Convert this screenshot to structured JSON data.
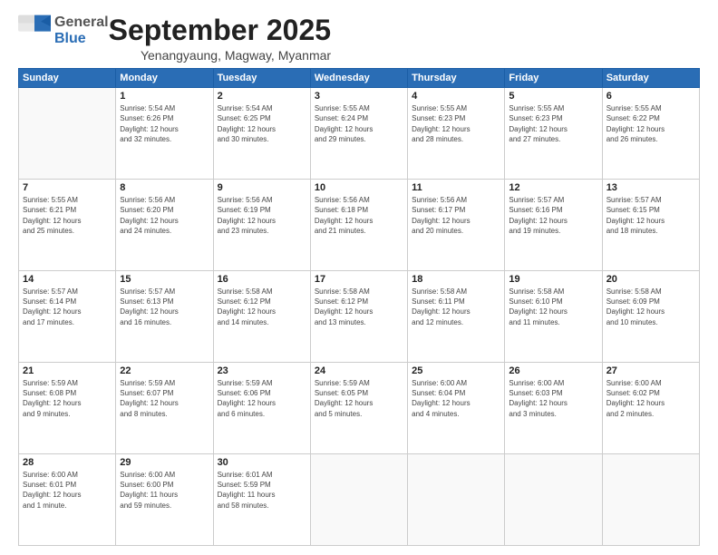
{
  "logo": {
    "general": "General",
    "blue": "Blue"
  },
  "title": "September 2025",
  "subtitle": "Yenangyaung, Magway, Myanmar",
  "days_of_week": [
    "Sunday",
    "Monday",
    "Tuesday",
    "Wednesday",
    "Thursday",
    "Friday",
    "Saturday"
  ],
  "weeks": [
    [
      {
        "day": "",
        "info": ""
      },
      {
        "day": "1",
        "info": "Sunrise: 5:54 AM\nSunset: 6:26 PM\nDaylight: 12 hours\nand 32 minutes."
      },
      {
        "day": "2",
        "info": "Sunrise: 5:54 AM\nSunset: 6:25 PM\nDaylight: 12 hours\nand 30 minutes."
      },
      {
        "day": "3",
        "info": "Sunrise: 5:55 AM\nSunset: 6:24 PM\nDaylight: 12 hours\nand 29 minutes."
      },
      {
        "day": "4",
        "info": "Sunrise: 5:55 AM\nSunset: 6:23 PM\nDaylight: 12 hours\nand 28 minutes."
      },
      {
        "day": "5",
        "info": "Sunrise: 5:55 AM\nSunset: 6:23 PM\nDaylight: 12 hours\nand 27 minutes."
      },
      {
        "day": "6",
        "info": "Sunrise: 5:55 AM\nSunset: 6:22 PM\nDaylight: 12 hours\nand 26 minutes."
      }
    ],
    [
      {
        "day": "7",
        "info": "Sunrise: 5:55 AM\nSunset: 6:21 PM\nDaylight: 12 hours\nand 25 minutes."
      },
      {
        "day": "8",
        "info": "Sunrise: 5:56 AM\nSunset: 6:20 PM\nDaylight: 12 hours\nand 24 minutes."
      },
      {
        "day": "9",
        "info": "Sunrise: 5:56 AM\nSunset: 6:19 PM\nDaylight: 12 hours\nand 23 minutes."
      },
      {
        "day": "10",
        "info": "Sunrise: 5:56 AM\nSunset: 6:18 PM\nDaylight: 12 hours\nand 21 minutes."
      },
      {
        "day": "11",
        "info": "Sunrise: 5:56 AM\nSunset: 6:17 PM\nDaylight: 12 hours\nand 20 minutes."
      },
      {
        "day": "12",
        "info": "Sunrise: 5:57 AM\nSunset: 6:16 PM\nDaylight: 12 hours\nand 19 minutes."
      },
      {
        "day": "13",
        "info": "Sunrise: 5:57 AM\nSunset: 6:15 PM\nDaylight: 12 hours\nand 18 minutes."
      }
    ],
    [
      {
        "day": "14",
        "info": "Sunrise: 5:57 AM\nSunset: 6:14 PM\nDaylight: 12 hours\nand 17 minutes."
      },
      {
        "day": "15",
        "info": "Sunrise: 5:57 AM\nSunset: 6:13 PM\nDaylight: 12 hours\nand 16 minutes."
      },
      {
        "day": "16",
        "info": "Sunrise: 5:58 AM\nSunset: 6:12 PM\nDaylight: 12 hours\nand 14 minutes."
      },
      {
        "day": "17",
        "info": "Sunrise: 5:58 AM\nSunset: 6:12 PM\nDaylight: 12 hours\nand 13 minutes."
      },
      {
        "day": "18",
        "info": "Sunrise: 5:58 AM\nSunset: 6:11 PM\nDaylight: 12 hours\nand 12 minutes."
      },
      {
        "day": "19",
        "info": "Sunrise: 5:58 AM\nSunset: 6:10 PM\nDaylight: 12 hours\nand 11 minutes."
      },
      {
        "day": "20",
        "info": "Sunrise: 5:58 AM\nSunset: 6:09 PM\nDaylight: 12 hours\nand 10 minutes."
      }
    ],
    [
      {
        "day": "21",
        "info": "Sunrise: 5:59 AM\nSunset: 6:08 PM\nDaylight: 12 hours\nand 9 minutes."
      },
      {
        "day": "22",
        "info": "Sunrise: 5:59 AM\nSunset: 6:07 PM\nDaylight: 12 hours\nand 8 minutes."
      },
      {
        "day": "23",
        "info": "Sunrise: 5:59 AM\nSunset: 6:06 PM\nDaylight: 12 hours\nand 6 minutes."
      },
      {
        "day": "24",
        "info": "Sunrise: 5:59 AM\nSunset: 6:05 PM\nDaylight: 12 hours\nand 5 minutes."
      },
      {
        "day": "25",
        "info": "Sunrise: 6:00 AM\nSunset: 6:04 PM\nDaylight: 12 hours\nand 4 minutes."
      },
      {
        "day": "26",
        "info": "Sunrise: 6:00 AM\nSunset: 6:03 PM\nDaylight: 12 hours\nand 3 minutes."
      },
      {
        "day": "27",
        "info": "Sunrise: 6:00 AM\nSunset: 6:02 PM\nDaylight: 12 hours\nand 2 minutes."
      }
    ],
    [
      {
        "day": "28",
        "info": "Sunrise: 6:00 AM\nSunset: 6:01 PM\nDaylight: 12 hours\nand 1 minute."
      },
      {
        "day": "29",
        "info": "Sunrise: 6:00 AM\nSunset: 6:00 PM\nDaylight: 11 hours\nand 59 minutes."
      },
      {
        "day": "30",
        "info": "Sunrise: 6:01 AM\nSunset: 5:59 PM\nDaylight: 11 hours\nand 58 minutes."
      },
      {
        "day": "",
        "info": ""
      },
      {
        "day": "",
        "info": ""
      },
      {
        "day": "",
        "info": ""
      },
      {
        "day": "",
        "info": ""
      }
    ]
  ]
}
